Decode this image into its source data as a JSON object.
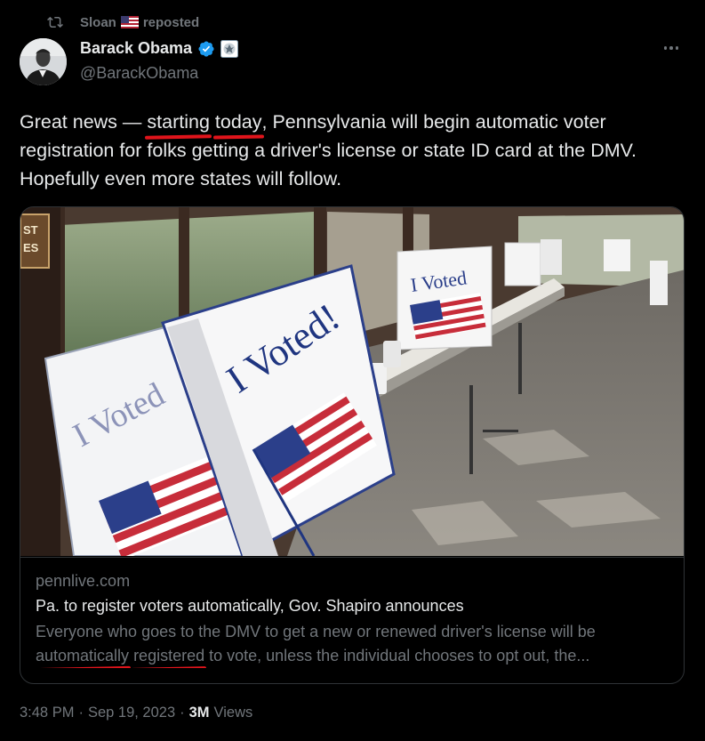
{
  "repost": {
    "user": "Sloan",
    "label": "reposted",
    "icon": "retweet-icon",
    "flag": "us-flag-emoji"
  },
  "author": {
    "name": "Barack Obama",
    "handle": "@BarackObama",
    "verified_icon": "verified-badge-icon",
    "affiliation_icon": "government-seal-icon",
    "verified_color": "#1d9bf0"
  },
  "more_icon": "more-options-icon",
  "tweet": {
    "segments": [
      "Great news — ",
      "starting",
      " ",
      "today",
      ", Pennsylvania will begin automatic voter registration for folks getting a driver's license or state ID card at the DMV. Hopefully even more states will follow."
    ],
    "underline_color": "#e0141b"
  },
  "card": {
    "image_signs": [
      "I Voted",
      "I Voted!",
      "I Voted",
      "I Voted",
      "ST",
      "ES"
    ],
    "domain": "pennlive.com",
    "title": "Pa. to register voters automatically, Gov. Shapiro announces",
    "desc_line1": "Everyone who goes to the DMV to get a new or renewed driver's license will be",
    "desc_segments": [
      "automatically",
      " ",
      "registered",
      " to vote, unless the individual chooses to opt out, the..."
    ]
  },
  "meta": {
    "time": "3:48 PM",
    "sep": "·",
    "date": "Sep 19, 2023",
    "sep2": "·",
    "views_count": "3M",
    "views_label": "Views"
  },
  "colors": {
    "background": "#000000",
    "text": "#e7e9ea",
    "muted": "#71767b",
    "border": "#2f3336"
  }
}
